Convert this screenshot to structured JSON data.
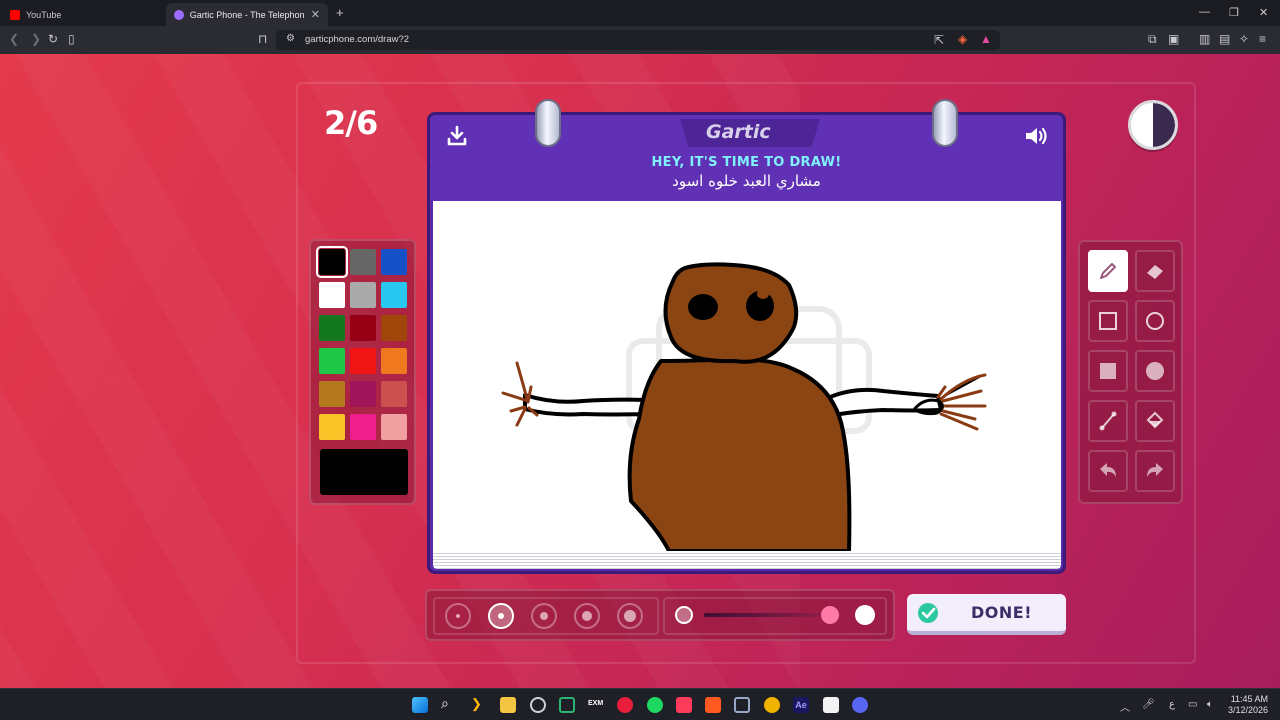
{
  "browser": {
    "tabs": [
      {
        "title": "YouTube",
        "active": false
      },
      {
        "title": "Gartic Phone - The Telephone Ga",
        "active": true
      }
    ],
    "url": "garticphone.com/draw?2"
  },
  "game": {
    "round": "2/6",
    "logo": "Gartic",
    "instruction": "HEY, IT'S TIME TO DRAW!",
    "prompt": "مشاري العبد خلوه اسود",
    "done_label": "DONE!",
    "timer_remaining_fraction": 0.5,
    "palette": [
      "#000000",
      "#666666",
      "#1450c8",
      "#ffffff",
      "#aaaaaa",
      "#28c8f0",
      "#14781e",
      "#960014",
      "#a0460a",
      "#1ec846",
      "#f01414",
      "#f0781e",
      "#b4781e",
      "#a0145a",
      "#cc5050",
      "#fac328",
      "#f01e8c",
      "#f0a0a0"
    ],
    "selected_color": "#000000",
    "brush_sizes": [
      1,
      2,
      3,
      4,
      5
    ],
    "selected_brush_size": 2,
    "opacity": 0.9,
    "tools": [
      "pencil",
      "eraser",
      "rectangle-outline",
      "ellipse-outline",
      "rectangle-fill",
      "ellipse-fill",
      "line",
      "fill-bucket",
      "undo",
      "redo"
    ],
    "selected_tool": "pencil"
  },
  "taskbar": {
    "time": "11:45 AM",
    "date": "3/12/2026",
    "input_lang": "ع"
  }
}
